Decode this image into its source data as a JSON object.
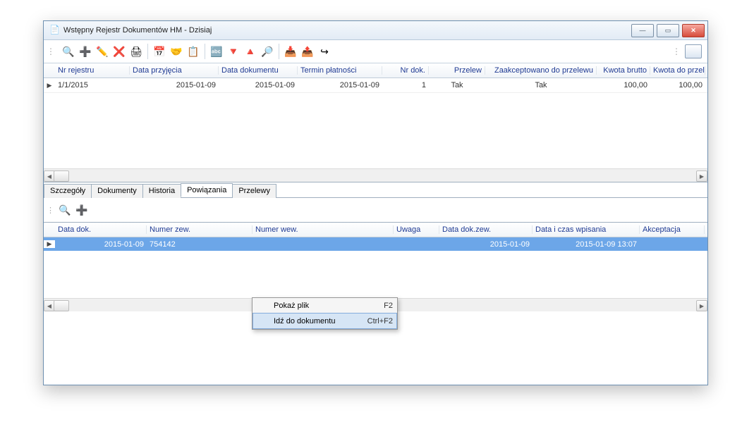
{
  "window": {
    "title": "Wstępny Rejestr Dokumentów HM - Dzisiaj"
  },
  "topGrid": {
    "headers": [
      "Nr rejestru",
      "Data przyjęcia",
      "Data dokumentu",
      "Termin płatności",
      "Nr dok.",
      "Przelew",
      "Zaakceptowano do przelewu",
      "Kwota brutto",
      "Kwota do przelewu"
    ],
    "rows": [
      {
        "nr": "1/1/2015",
        "dprz": "2015-01-09",
        "ddok": "2015-01-09",
        "term": "2015-01-09",
        "nrd": "1",
        "przelew": "Tak",
        "zaak": "Tak",
        "kbrutto": "100,00",
        "kdop": "100,00"
      }
    ]
  },
  "tabs": {
    "items": [
      "Szczegóły",
      "Dokumenty",
      "Historia",
      "Powiązania",
      "Przelewy"
    ],
    "active": 3
  },
  "bottomGrid": {
    "headers": [
      "Data dok.",
      "Numer zew.",
      "Numer wew.",
      "Uwaga",
      "Data dok.zew.",
      "Data i czas wpisania",
      "Akceptacja"
    ],
    "rows": [
      {
        "ddok": "2015-01-09",
        "nzew": "754142",
        "nwew": "",
        "uwaga": "",
        "dzew": "2015-01-09",
        "dwpis": "2015-01-09 13:07",
        "akc": ""
      }
    ]
  },
  "contextMenu": {
    "items": [
      {
        "label": "Pokaż plik",
        "shortcut": "F2"
      },
      {
        "label": "Idź do dokumentu",
        "shortcut": "Ctrl+F2"
      }
    ],
    "highlighted": 1
  },
  "toolbarIcons": [
    "🔍",
    "➕",
    "✏️",
    "❌",
    "🖨",
    "📅",
    "🤝",
    "📋",
    "🔤",
    "🔻",
    "🔺",
    "🔎",
    "📥",
    "📤",
    "↪"
  ],
  "subIcons": [
    "🔍",
    "➕"
  ]
}
